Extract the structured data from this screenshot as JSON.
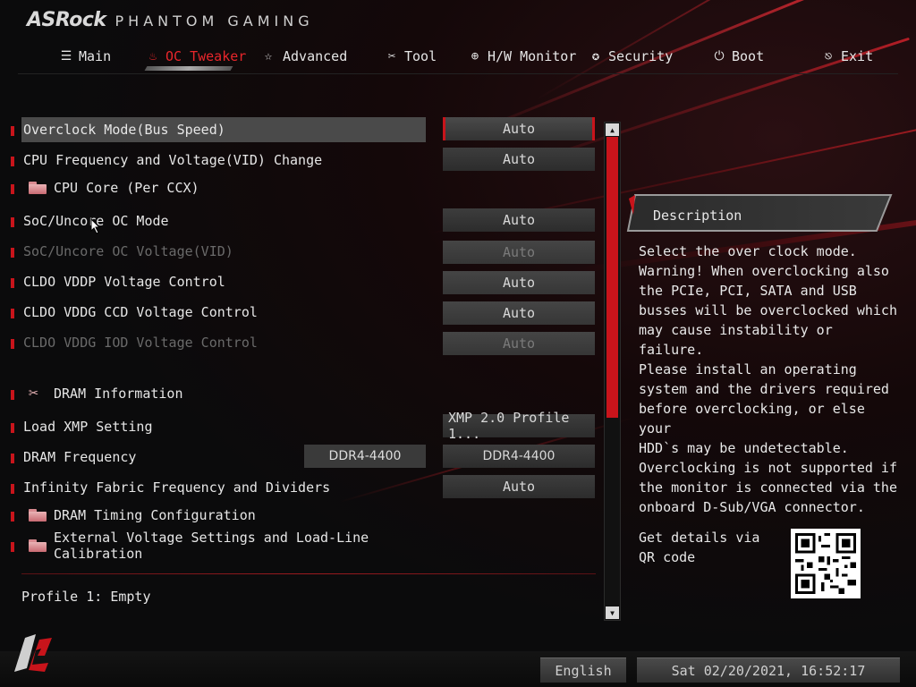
{
  "brand": {
    "logo": "ASRock",
    "sub": "PHANTOM GAMING"
  },
  "nav": [
    {
      "label": "Main",
      "icon": "list-icon"
    },
    {
      "label": "OC Tweaker",
      "icon": "flame-icon"
    },
    {
      "label": "Advanced",
      "icon": "star-icon"
    },
    {
      "label": "Tool",
      "icon": "tools-icon"
    },
    {
      "label": "H/W Monitor",
      "icon": "crosshair-icon"
    },
    {
      "label": "Security",
      "icon": "shield-badge-icon"
    },
    {
      "label": "Boot",
      "icon": "power-icon"
    },
    {
      "label": "Exit",
      "icon": "exit-door-icon"
    }
  ],
  "menu": {
    "overclock_mode": {
      "label": "Overclock Mode(Bus Speed)",
      "value": "Auto"
    },
    "cpu_freq_vid": {
      "label": "CPU Frequency and Voltage(VID) Change",
      "value": "Auto"
    },
    "cpu_core": {
      "label": "CPU Core (Per CCX)"
    },
    "soc_uncore_mode": {
      "label": "SoC/Uncore OC Mode",
      "value": "Auto"
    },
    "soc_uncore_voltage": {
      "label": "SoC/Uncore OC Voltage(VID)",
      "value": "Auto"
    },
    "cldo_vddp": {
      "label": "CLDO VDDP Voltage Control",
      "value": "Auto"
    },
    "cldo_vddg_ccd": {
      "label": "CLDO VDDG CCD Voltage Control",
      "value": "Auto"
    },
    "cldo_vddg_iod": {
      "label": "CLDO VDDG IOD Voltage Control",
      "value": "Auto"
    },
    "dram_info": {
      "label": "DRAM Information"
    },
    "load_xmp": {
      "label": "Load XMP Setting",
      "value": "XMP 2.0 Profile 1..."
    },
    "dram_freq": {
      "label": "DRAM Frequency",
      "current": "DDR4-4400",
      "value": "DDR4-4400"
    },
    "infinity_fabric": {
      "label": "Infinity Fabric Frequency and Dividers",
      "value": "Auto"
    },
    "dram_timing": {
      "label": "DRAM Timing Configuration"
    },
    "ext_voltage": {
      "label": "External Voltage Settings and Load-Line Calibration"
    }
  },
  "profile_text": "Profile 1: Empty",
  "description": {
    "title": "Description",
    "text": "Select the over clock mode.\nWarning! When overclocking also\nthe PCIe, PCI, SATA and USB\nbusses will be overclocked which\nmay cause instability or failure.\nPlease install an operating\nsystem and the drivers required\nbefore overclocking, or else your\nHDD`s may be undetectable.\nOverclocking is not supported if\nthe monitor is connected via the\nonboard D-Sub/VGA connector.",
    "qr_text": "Get details via QR code"
  },
  "footer": {
    "language": "English",
    "datetime": "Sat 02/20/2021, 16:52:17"
  },
  "colors": {
    "accent": "#c8141b",
    "active_tab": "#e8262b"
  }
}
